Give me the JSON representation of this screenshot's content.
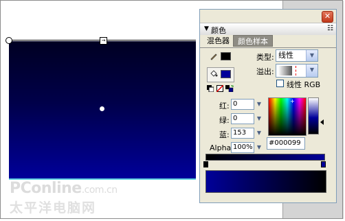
{
  "watermark": {
    "main": "PConline",
    "suffix": ".com.cn",
    "sub": "太平洋电脑网"
  },
  "panel": {
    "close_glyph": "✕",
    "collapse_glyph": "▼",
    "title": "颜色",
    "options_glyph": "☷",
    "tabs": [
      {
        "label": "混色器",
        "active": true
      },
      {
        "label": "颜色样本",
        "active": false
      }
    ],
    "type_label": "类型:",
    "type_value": "线性",
    "overflow_label": "溢出:",
    "linear_rgb_label": "线性 RGB",
    "channels": [
      {
        "label": "红:",
        "value": "0"
      },
      {
        "label": "绿:",
        "value": "0"
      },
      {
        "label": "蓝:",
        "value": "153"
      }
    ],
    "alpha_label": "Alpha:",
    "alpha_value": "100%",
    "hex_value": "#000099",
    "icons": {
      "stroke": "pencil-icon",
      "fill": "paint-bucket-icon",
      "black_white": "black-white-icon",
      "no_color": "no-color-icon",
      "swap": "swap-colors-icon"
    }
  },
  "colors": {
    "gradient_start": "#000000",
    "gradient_end": "#000099",
    "stroke_swatch": "#000000",
    "fill_swatch": "#000099"
  }
}
